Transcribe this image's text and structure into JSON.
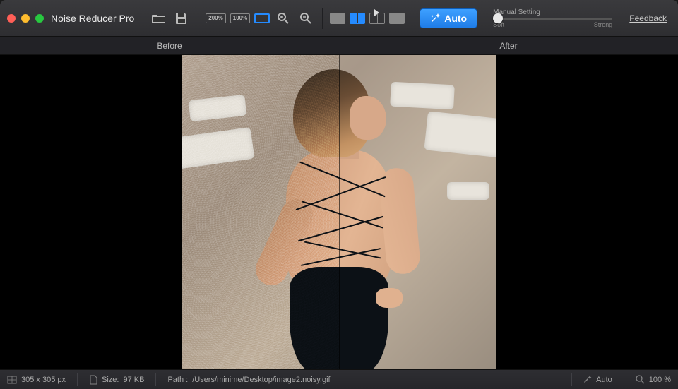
{
  "app": {
    "title": "Noise Reducer Pro"
  },
  "toolbar": {
    "zoom_200": "200%",
    "zoom_100": "100%",
    "auto_label": "Auto",
    "slider": {
      "label": "Manual Setting",
      "min_label": "Soft",
      "max_label": "Strong"
    },
    "feedback": "Feedback"
  },
  "comparison": {
    "before": "Before",
    "after": "After"
  },
  "status": {
    "dimensions": "305 x 305 px",
    "size_label": "Size:",
    "size_value": "97 KB",
    "path_label": "Path :",
    "path_value": "/Users/minime/Desktop/image2.noisy.gif",
    "mode": "Auto",
    "zoom": "100 %"
  }
}
